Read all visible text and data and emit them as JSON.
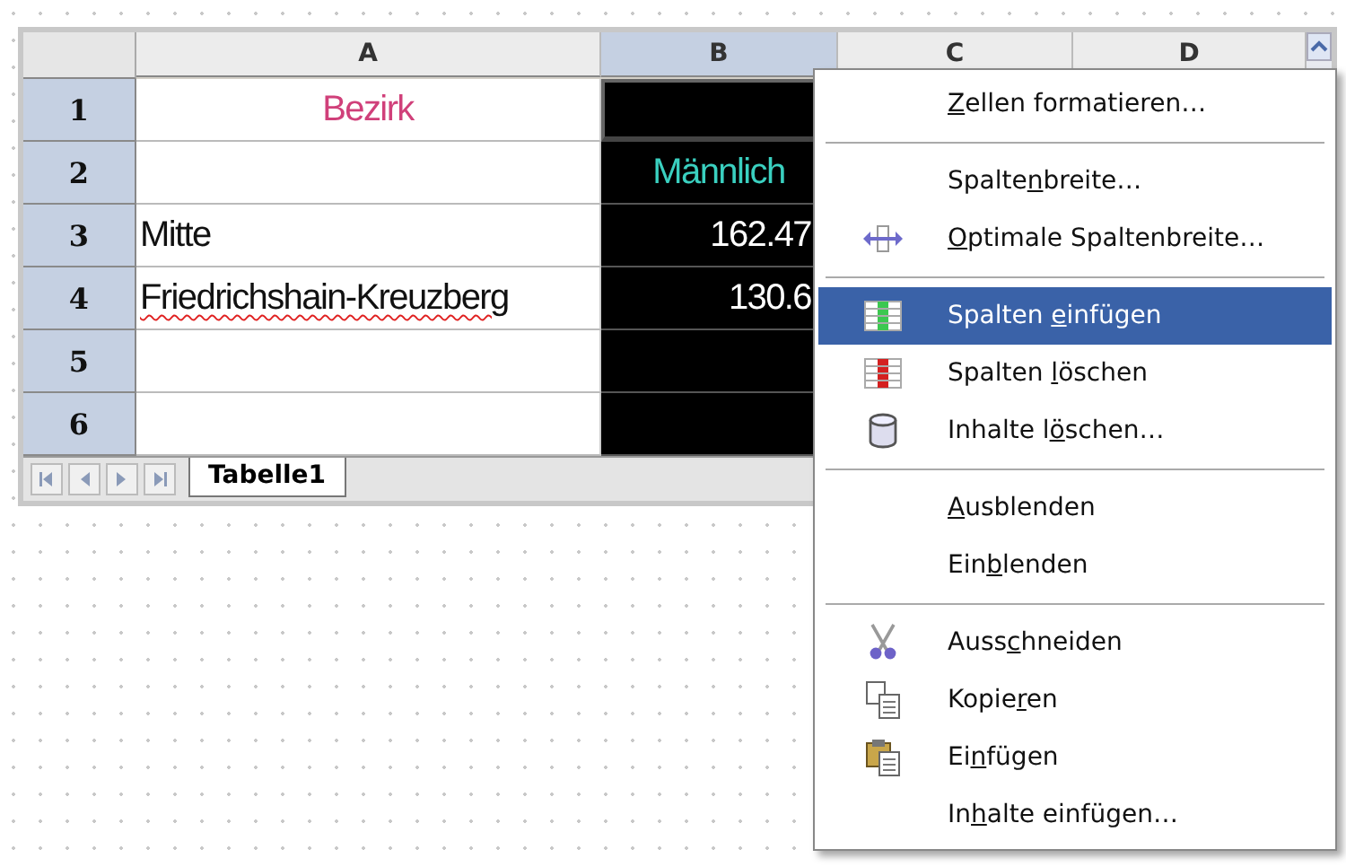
{
  "sheet": {
    "columns": [
      {
        "label": "A",
        "selected": false,
        "kind": "light"
      },
      {
        "label": "B",
        "selected": true,
        "kind": "dark"
      },
      {
        "label": "C",
        "selected": false,
        "kind": "light"
      },
      {
        "label": "D",
        "selected": false,
        "kind": "light"
      }
    ],
    "rows": [
      {
        "header": "1",
        "cells": [
          {
            "kind": "heading",
            "text": "Bezirk"
          },
          {
            "kind": "active"
          }
        ]
      },
      {
        "header": "2",
        "cells": [
          {
            "kind": "empty"
          },
          {
            "kind": "subheading",
            "text": "Männlich"
          }
        ]
      },
      {
        "header": "3",
        "cells": [
          {
            "kind": "label",
            "text": "Mitte",
            "spelling_error": false
          },
          {
            "kind": "number",
            "text": "162.47"
          }
        ]
      },
      {
        "header": "4",
        "cells": [
          {
            "kind": "label",
            "text": "Friedrichshain-Kreuzberg",
            "spelling_error": true
          },
          {
            "kind": "number",
            "text": "130.6"
          }
        ]
      },
      {
        "header": "5",
        "cells": [
          {
            "kind": "empty"
          },
          {
            "kind": "empty"
          }
        ]
      },
      {
        "header": "6",
        "cells": [
          {
            "kind": "empty"
          },
          {
            "kind": "empty"
          }
        ]
      }
    ],
    "tabs": [
      {
        "label": "Tabelle1",
        "selected": true
      }
    ]
  },
  "context_menu": [
    {
      "kind": "item",
      "label": {
        "key": "Z",
        "after": "ellen formatieren…"
      },
      "selected": false
    },
    {
      "kind": "separator"
    },
    {
      "kind": "item",
      "label": {
        "before": "Spalte",
        "key": "n",
        "after": "breite…"
      },
      "selected": false
    },
    {
      "kind": "item",
      "label": {
        "key": "O",
        "after": "ptimale Spaltenbreite…"
      },
      "selected": false
    },
    {
      "kind": "separator"
    },
    {
      "kind": "item",
      "label": {
        "before": "Spalten ",
        "key": "e",
        "after": "infügen"
      },
      "selected": true
    },
    {
      "kind": "item",
      "label": {
        "before": "Spalten ",
        "key": "l",
        "after": "öschen"
      },
      "selected": false
    },
    {
      "kind": "item",
      "label": {
        "before": "Inhalte l",
        "key": "ö",
        "after": "schen…"
      },
      "selected": false
    },
    {
      "kind": "separator"
    },
    {
      "kind": "item",
      "label": {
        "key": "A",
        "after": "usblenden"
      },
      "selected": false
    },
    {
      "kind": "item",
      "label": {
        "before": "Ein",
        "key": "b",
        "after": "lenden"
      },
      "selected": false
    },
    {
      "kind": "separator"
    },
    {
      "kind": "item",
      "label": {
        "before": "Auss",
        "key": "c",
        "after": "hneiden"
      },
      "selected": false
    },
    {
      "kind": "item",
      "label": {
        "before": "Kopie",
        "key": "r",
        "after": "en"
      },
      "selected": false
    },
    {
      "kind": "item",
      "label": {
        "before": "Ei",
        "key": "n",
        "after": "fügen"
      },
      "selected": false
    },
    {
      "kind": "item",
      "label": {
        "before": "In",
        "key": "h",
        "after": "alte einfügen…"
      },
      "selected": false
    }
  ]
}
